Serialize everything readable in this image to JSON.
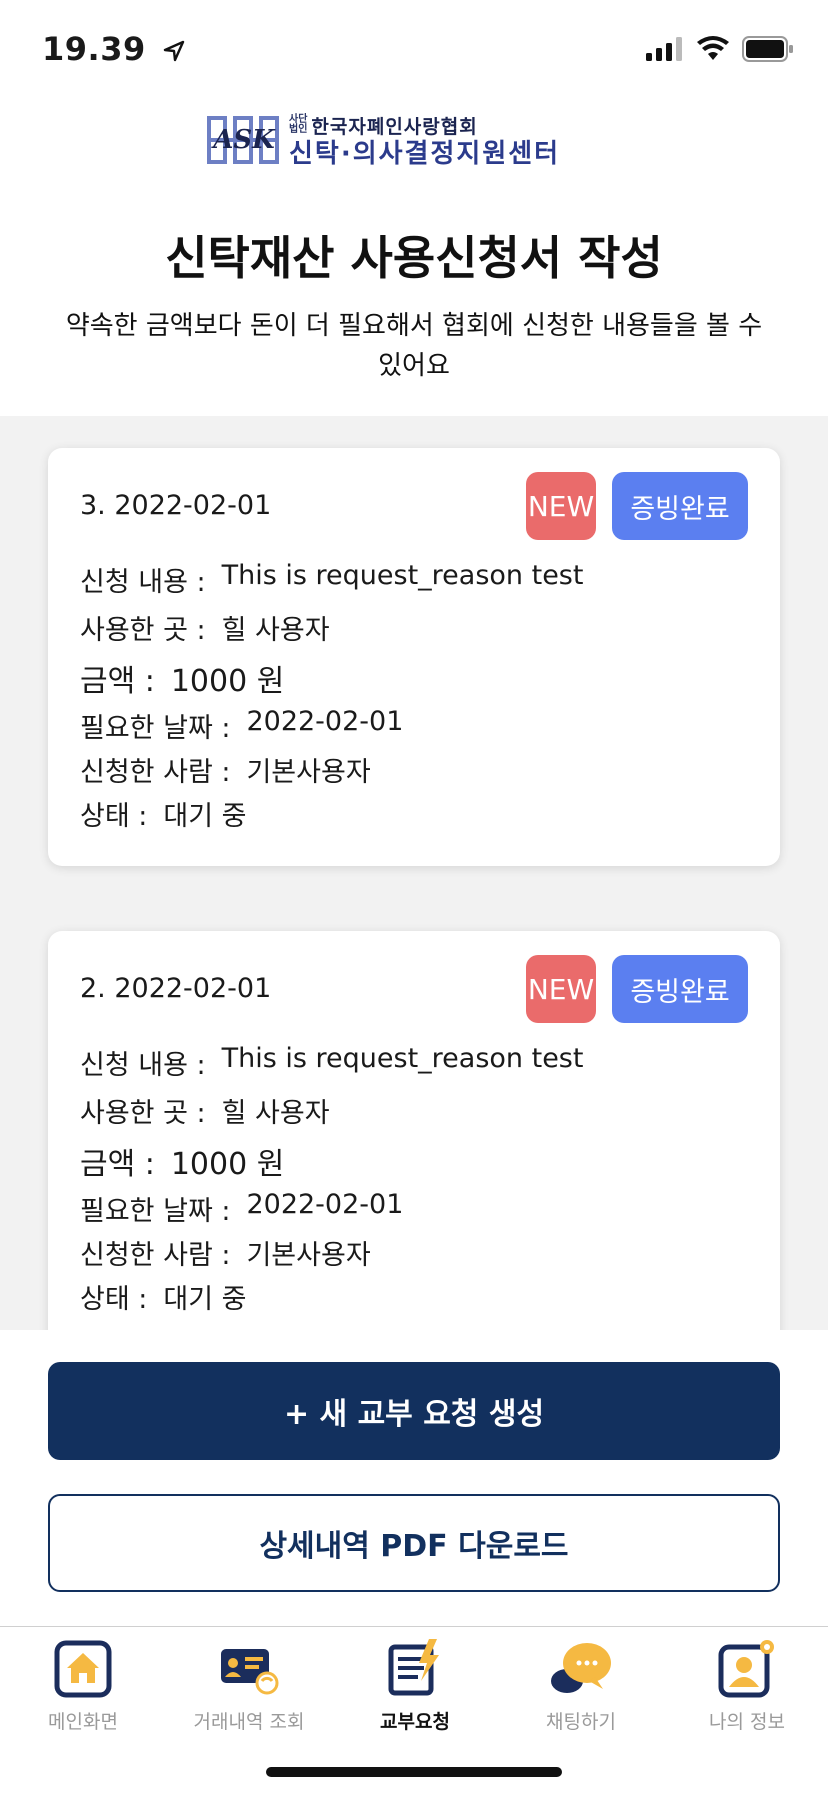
{
  "status": {
    "time": "19.39"
  },
  "header": {
    "logo_text": "ASK",
    "logo_small_1": "사단",
    "logo_small_2": "법인",
    "org_name": "한국자폐인사랑협회",
    "center_name": "신탁·의사결정지원센터"
  },
  "page": {
    "title": "신탁재산 사용신청서 작성",
    "description": "약속한 금액보다 돈이 더 필요해서 협회에 신청한 내용들을 볼 수 있어요"
  },
  "labels": {
    "request": "신청 내용 :",
    "place": "사용한 곳 :",
    "amount": "금액 :",
    "date_needed": "필요한 날짜 :",
    "applicant": "신청한 사람 :",
    "status": "상태 :"
  },
  "requests": [
    {
      "heading": "3. 2022-02-01",
      "badge_new": "NEW",
      "badge_proof": "증빙완료",
      "request": "This is request_reason test",
      "place": "힐 사용자",
      "amount": "1000 원",
      "date_needed": "2022-02-01",
      "applicant": "기본사용자",
      "status": "대기 중"
    },
    {
      "heading": "2. 2022-02-01",
      "badge_new": "NEW",
      "badge_proof": "증빙완료",
      "request": "This is request_reason test",
      "place": "힐 사용자",
      "amount": "1000 원",
      "date_needed": "2022-02-01",
      "applicant": "기본사용자",
      "status": "대기 중"
    }
  ],
  "actions": {
    "new_request": "+ 새 교부 요청 생성",
    "download_pdf": "상세내역 PDF 다운로드"
  },
  "tabs": [
    {
      "label": "메인화면",
      "icon": "home-icon"
    },
    {
      "label": "거래내역 조회",
      "icon": "transactions-icon"
    },
    {
      "label": "교부요청",
      "icon": "request-icon"
    },
    {
      "label": "채팅하기",
      "icon": "chat-icon"
    },
    {
      "label": "나의 정보",
      "icon": "profile-icon"
    }
  ],
  "colors": {
    "primary": "#12305e",
    "badge_new": "#ea6b6b",
    "badge_proof": "#5b7ff0",
    "list_bg": "#f2f2f2",
    "chat_accent": "#f5b942"
  }
}
